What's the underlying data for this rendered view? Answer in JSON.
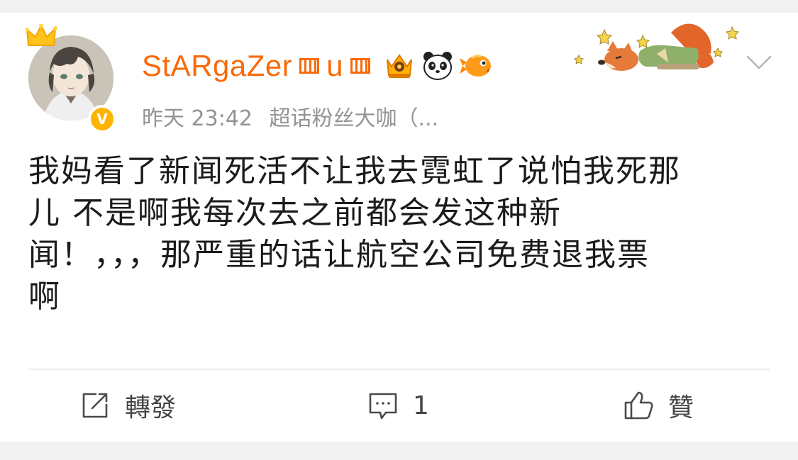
{
  "post": {
    "username": "StARgaZer",
    "username_mid": "u",
    "timestamp": "昨天 23:42",
    "source": "超话粉丝大咖（...",
    "text": "我妈看了新闻死活不让我去霓虹了说怕我死那\n儿 不是啊我每次去之前都会发这种新\n闻！，，，那严重的话让航空公司免费退我票\n啊"
  },
  "actions": {
    "repost_label": "轉發",
    "comment_count": "1",
    "like_label": "贊"
  },
  "icons": {
    "crown": "crown-icon",
    "verified": "verified-v-icon",
    "vip_badge": "vip-crown-badge-icon",
    "panda": "panda-icon",
    "fish": "goldfish-icon",
    "more": "chevron-down-icon",
    "repost": "repost-icon",
    "comment": "comment-icon",
    "like": "thumbs-up-icon"
  },
  "colors": {
    "username": "#f86a0a",
    "meta": "#939393",
    "text": "#1b1b1b",
    "verified": "#ffb400"
  }
}
